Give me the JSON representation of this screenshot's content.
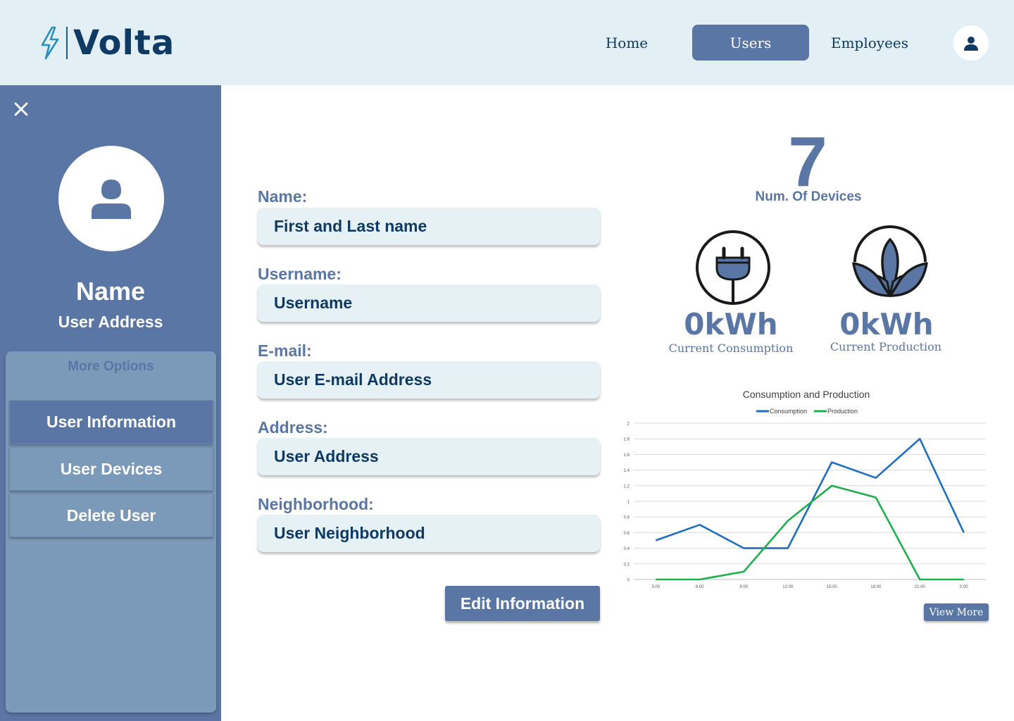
{
  "header": {
    "logo_text": "Volta",
    "nav": {
      "home": "Home",
      "users": "Users",
      "employees": "Employees"
    }
  },
  "sidebar": {
    "name": "Name",
    "address": "User Address",
    "options_title": "More Options",
    "options": [
      "User Information",
      "User Devices",
      "Delete User"
    ]
  },
  "form": {
    "fields": [
      {
        "label": "Name:",
        "value": "First and Last name"
      },
      {
        "label": "Username:",
        "value": "Username"
      },
      {
        "label": "E-mail:",
        "value": "User E-mail Address"
      },
      {
        "label": "Address:",
        "value": "User Address"
      },
      {
        "label": "Neighborhood:",
        "value": "User Neighborhood"
      }
    ],
    "edit_button": "Edit Information"
  },
  "stats": {
    "devices_count": "7",
    "devices_label": "Num. Of Devices",
    "consumption_value": "0kWh",
    "consumption_label": "Current Consumption",
    "production_value": "0kWh",
    "production_label": "Current Production"
  },
  "icons": {
    "bolt": "bolt-icon",
    "profile": "user-icon",
    "close": "close-icon",
    "avatar": "user-icon",
    "plug": "plug-icon",
    "lotus": "lotus-icon"
  },
  "colors": {
    "primary": "#5a76a4",
    "header_bg": "#e2eff5",
    "field_bg": "#e6f1f6",
    "dark_text": "#0e3a63",
    "options_bg": "#7b99b8",
    "consumption": "#1f6fbf",
    "production": "#1db04b"
  },
  "chart_data": {
    "type": "line",
    "title": "Consumption and Production",
    "categories": [
      "3:00",
      "6:00",
      "9:00",
      "12:00",
      "15:00",
      "18:00",
      "21:00",
      "0:00"
    ],
    "series": [
      {
        "name": "Consumption",
        "color": "#1f6fbf",
        "values": [
          0.5,
          0.7,
          0.4,
          0.4,
          1.5,
          1.3,
          1.8,
          0.6
        ]
      },
      {
        "name": "Production",
        "color": "#1db04b",
        "values": [
          0,
          0,
          0.1,
          0.75,
          1.2,
          1.05,
          0,
          0
        ]
      }
    ],
    "yticks": [
      "0",
      "0.2",
      "0.4",
      "0.6",
      "0.8",
      "1",
      "1.2",
      "1.4",
      "1.6",
      "1.8",
      "2"
    ],
    "ylim": [
      0,
      2
    ],
    "grid": true,
    "legend": "top"
  },
  "chart_button": "View More"
}
